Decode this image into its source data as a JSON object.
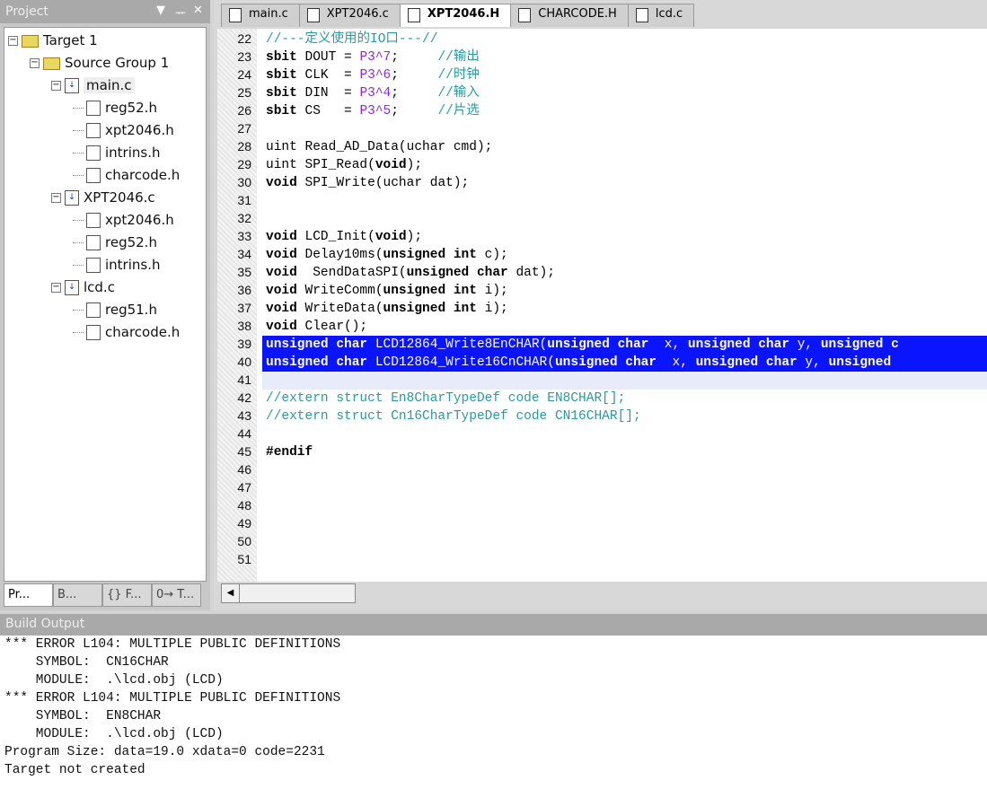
{
  "project": {
    "title": "Project",
    "controls": [
      "▼",
      "ᅲ",
      "✕"
    ],
    "tree": [
      {
        "label": "Target 1",
        "level": 0,
        "type": "target",
        "toggle": "−"
      },
      {
        "label": "Source Group 1",
        "level": 1,
        "type": "folder",
        "toggle": "−"
      },
      {
        "label": "main.c",
        "level": 2,
        "type": "c",
        "toggle": "−",
        "selected": true
      },
      {
        "label": "reg52.h",
        "level": 3,
        "type": "h"
      },
      {
        "label": "xpt2046.h",
        "level": 3,
        "type": "h"
      },
      {
        "label": "intrins.h",
        "level": 3,
        "type": "h"
      },
      {
        "label": "charcode.h",
        "level": 3,
        "type": "h"
      },
      {
        "label": "XPT2046.c",
        "level": 2,
        "type": "c",
        "toggle": "−"
      },
      {
        "label": "xpt2046.h",
        "level": 3,
        "type": "h"
      },
      {
        "label": "reg52.h",
        "level": 3,
        "type": "h"
      },
      {
        "label": "intrins.h",
        "level": 3,
        "type": "h"
      },
      {
        "label": "lcd.c",
        "level": 2,
        "type": "c",
        "toggle": "−"
      },
      {
        "label": "reg51.h",
        "level": 3,
        "type": "h"
      },
      {
        "label": "charcode.h",
        "level": 3,
        "type": "h"
      }
    ],
    "tabs": [
      {
        "label": "Pr...",
        "icon": "project-icon",
        "active": true
      },
      {
        "label": "B...",
        "icon": "books-icon"
      },
      {
        "label": "{} F...",
        "icon": "functions-icon"
      },
      {
        "label": "0→ T...",
        "icon": "templates-icon"
      }
    ]
  },
  "editor": {
    "tabs": [
      {
        "label": "main.c"
      },
      {
        "label": "XPT2046.c"
      },
      {
        "label": "XPT2046.H",
        "active": true
      },
      {
        "label": "CHARCODE.H"
      },
      {
        "label": "lcd.c"
      }
    ],
    "lines": [
      {
        "n": "22",
        "seg": [
          [
            "c",
            "//---定义使用的IO口---//"
          ]
        ]
      },
      {
        "n": "23",
        "seg": [
          [
            "k",
            "sbit"
          ],
          [
            "p",
            " DOUT = "
          ],
          [
            "n",
            "P3^7"
          ],
          [
            "p",
            ";     "
          ],
          [
            "c",
            "//输出"
          ]
        ]
      },
      {
        "n": "24",
        "seg": [
          [
            "k",
            "sbit"
          ],
          [
            "p",
            " CLK  = "
          ],
          [
            "n",
            "P3^6"
          ],
          [
            "p",
            ";     "
          ],
          [
            "c",
            "//时钟"
          ]
        ]
      },
      {
        "n": "25",
        "seg": [
          [
            "k",
            "sbit"
          ],
          [
            "p",
            " DIN  = "
          ],
          [
            "n",
            "P3^4"
          ],
          [
            "p",
            ";     "
          ],
          [
            "c",
            "//输入"
          ]
        ]
      },
      {
        "n": "26",
        "seg": [
          [
            "k",
            "sbit"
          ],
          [
            "p",
            " CS   = "
          ],
          [
            "n",
            "P3^5"
          ],
          [
            "p",
            ";     "
          ],
          [
            "c",
            "//片选"
          ]
        ]
      },
      {
        "n": "27",
        "seg": []
      },
      {
        "n": "28",
        "seg": [
          [
            "p",
            "uint Read_AD_Data(uchar cmd);"
          ]
        ]
      },
      {
        "n": "29",
        "seg": [
          [
            "p",
            "uint SPI_Read("
          ],
          [
            "k",
            "void"
          ],
          [
            "p",
            ");"
          ]
        ]
      },
      {
        "n": "30",
        "seg": [
          [
            "k",
            "void"
          ],
          [
            "p",
            " SPI_Write(uchar dat);"
          ]
        ]
      },
      {
        "n": "31",
        "seg": []
      },
      {
        "n": "32",
        "seg": []
      },
      {
        "n": "33",
        "seg": [
          [
            "k",
            "void"
          ],
          [
            "p",
            " LCD_Init("
          ],
          [
            "k",
            "void"
          ],
          [
            "p",
            ");"
          ]
        ]
      },
      {
        "n": "34",
        "seg": [
          [
            "k",
            "void"
          ],
          [
            "p",
            " Delay10ms("
          ],
          [
            "k",
            "unsigned int"
          ],
          [
            "p",
            " c);"
          ]
        ]
      },
      {
        "n": "35",
        "seg": [
          [
            "k",
            "void"
          ],
          [
            "p",
            "  SendDataSPI("
          ],
          [
            "k",
            "unsigned char"
          ],
          [
            "p",
            " dat);"
          ]
        ]
      },
      {
        "n": "36",
        "seg": [
          [
            "k",
            "void"
          ],
          [
            "p",
            " WriteComm("
          ],
          [
            "k",
            "unsigned int"
          ],
          [
            "p",
            " i);"
          ]
        ]
      },
      {
        "n": "37",
        "seg": [
          [
            "k",
            "void"
          ],
          [
            "p",
            " WriteData("
          ],
          [
            "k",
            "unsigned int"
          ],
          [
            "p",
            " i);"
          ]
        ]
      },
      {
        "n": "38",
        "seg": [
          [
            "k",
            "void"
          ],
          [
            "p",
            " Clear();"
          ]
        ]
      },
      {
        "n": "39",
        "hl": true,
        "seg": [
          [
            "k",
            "unsigned char"
          ],
          [
            "p",
            " LCD12864_Write8EnCHAR("
          ],
          [
            "k",
            "unsigned char"
          ],
          [
            "p",
            "  x, "
          ],
          [
            "k",
            "unsigned char"
          ],
          [
            "p",
            " y, "
          ],
          [
            "k",
            "unsigned c"
          ]
        ]
      },
      {
        "n": "40",
        "hl": true,
        "seg": [
          [
            "k",
            "unsigned char"
          ],
          [
            "p",
            " LCD12864_Write16CnCHAR("
          ],
          [
            "k",
            "unsigned char"
          ],
          [
            "p",
            "  x, "
          ],
          [
            "k",
            "unsigned char"
          ],
          [
            "p",
            " y, "
          ],
          [
            "k",
            "unsigned"
          ]
        ]
      },
      {
        "n": "41",
        "cur": true,
        "seg": []
      },
      {
        "n": "42",
        "seg": [
          [
            "c",
            "//extern struct En8CharTypeDef code EN8CHAR[];"
          ]
        ]
      },
      {
        "n": "43",
        "seg": [
          [
            "c",
            "//extern struct Cn16CharTypeDef code CN16CHAR[];"
          ]
        ]
      },
      {
        "n": "44",
        "seg": []
      },
      {
        "n": "45",
        "seg": [
          [
            "k",
            "#endif"
          ]
        ]
      },
      {
        "n": "46",
        "seg": []
      },
      {
        "n": "47",
        "seg": []
      },
      {
        "n": "48",
        "seg": []
      },
      {
        "n": "49",
        "seg": []
      },
      {
        "n": "50",
        "seg": []
      },
      {
        "n": "51",
        "seg": []
      }
    ]
  },
  "build": {
    "title": "Build Output",
    "lines": [
      "*** ERROR L104: MULTIPLE PUBLIC DEFINITIONS",
      "    SYMBOL:  CN16CHAR",
      "    MODULE:  .\\lcd.obj (LCD)",
      "*** ERROR L104: MULTIPLE PUBLIC DEFINITIONS",
      "    SYMBOL:  EN8CHAR",
      "    MODULE:  .\\lcd.obj (LCD)",
      "Program Size: data=19.0 xdata=0 code=2231",
      "Target not created"
    ]
  },
  "colors": {
    "selection": "#0a14ff",
    "comment": "#2a9aa0",
    "literal": "#8a2be2"
  }
}
